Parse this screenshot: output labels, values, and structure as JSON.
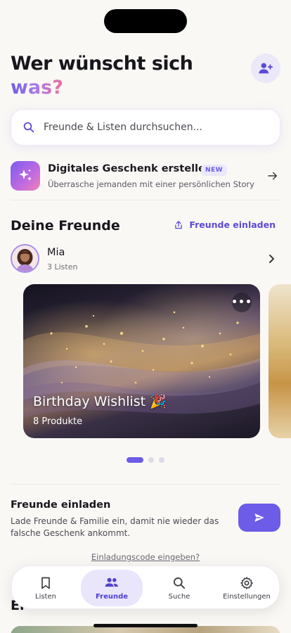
{
  "header": {
    "title_line1": "Wer wünscht sich",
    "title_line2": "was?"
  },
  "search": {
    "placeholder": "Freunde & Listen durchsuchen..."
  },
  "promo": {
    "title": "Digitales Geschenk erstellen",
    "badge": "NEW",
    "subtitle": "Überrasche jemanden mit einer persönlichen Story"
  },
  "friends_section": {
    "title": "Deine Freunde",
    "invite_label": "Freunde einladen"
  },
  "friend": {
    "name": "Mia",
    "list_count": "3 Listen"
  },
  "wishlist_card": {
    "title": "Birthday Wishlist 🎉",
    "product_count": "8 Produkte",
    "more_label": "•••"
  },
  "carousel": {
    "page_count": 3,
    "active_index": 0
  },
  "invite": {
    "title": "Freunde einladen",
    "text": "Lade Freunde & Familie ein, damit nie wieder das falsche Geschenk ankommt.",
    "code_link": "Einladungscode eingeben?"
  },
  "behind_title": "Er",
  "tabbar": {
    "tabs": [
      {
        "label": "Listen",
        "icon": "bookmark-icon"
      },
      {
        "label": "Freunde",
        "icon": "people-icon"
      },
      {
        "label": "Suche",
        "icon": "search-icon"
      },
      {
        "label": "Einstellungen",
        "icon": "gear-icon"
      }
    ],
    "active": "Freunde"
  },
  "colors": {
    "accent": "#6c5ce7",
    "background": "#faf8f5",
    "active_tab_bg": "#e9e5fb"
  }
}
